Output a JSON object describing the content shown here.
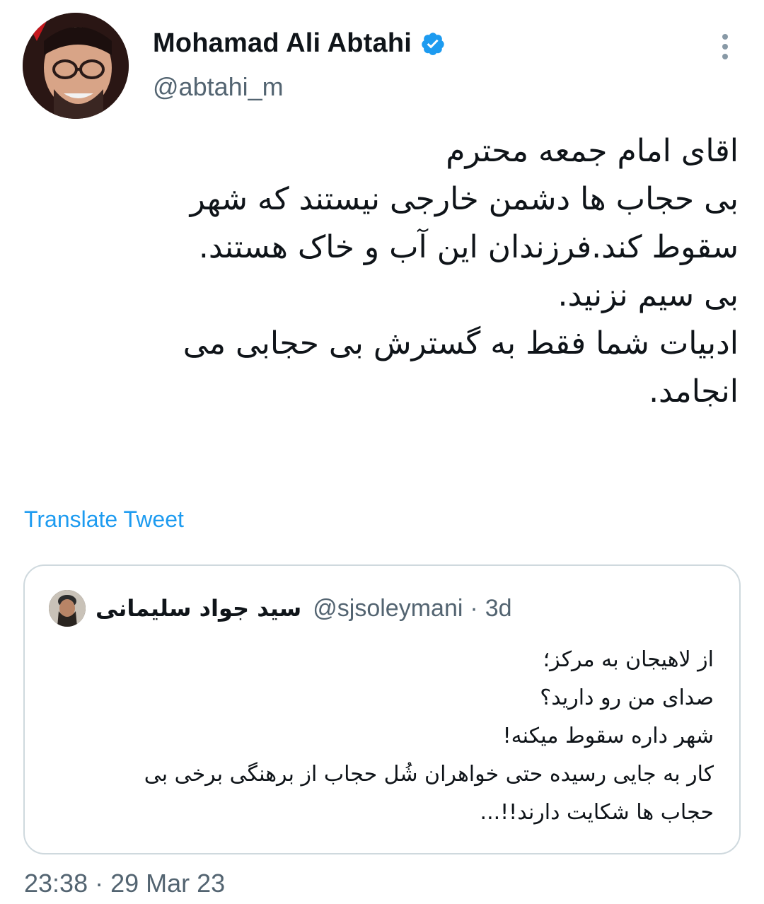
{
  "author": {
    "display_name": "Mohamad Ali Abtahi",
    "handle": "@abtahi_m",
    "verified": true,
    "verified_color": "#1d9bf0"
  },
  "more_icon": "more-vertical-icon",
  "tweet": {
    "lines": [
      "اقای امام جمعه محترم",
      "بی حجاب ها دشمن خارجی نیستند که شهر",
      "سقوط کند.فرزندان این آب و خاک هستند.",
      "بی سیم نزنید.",
      "ادبیات شما فقط به گسترش بی حجابی  می",
      "انجامد."
    ],
    "translate_label": "Translate Tweet"
  },
  "quoted_tweet": {
    "display_name": "سید جواد سلیمانی",
    "handle": "@sjsoleymani",
    "separator": "·",
    "age": "3d",
    "lines": [
      "از لاهیجان به مرکز؛",
      "صدای من رو دارید؟",
      "شهر داره سقوط میکنه!",
      "کار به جایی رسیده حتی خواهران شُل حجاب از برهنگی برخی بی",
      "حجاب ها شکایت دارند!!..."
    ]
  },
  "timestamp": "23:38 · 29 Mar 23",
  "colors": {
    "accent": "#1d9bf0",
    "secondary_text": "#536471",
    "border": "#cfd9de"
  }
}
